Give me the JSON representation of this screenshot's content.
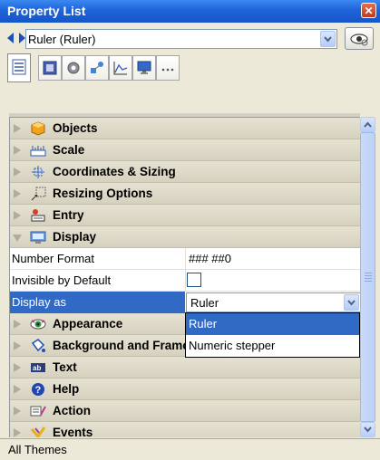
{
  "window": {
    "title": "Property List",
    "close_glyph": "✕"
  },
  "object_selector": {
    "value": "Ruler (Ruler)"
  },
  "tabs": [
    {
      "name": "properties",
      "icon": "list-icon",
      "active": true
    },
    {
      "name": "object",
      "icon": "object-icon",
      "active": false
    },
    {
      "name": "settings",
      "icon": "gear-icon",
      "active": false
    },
    {
      "name": "shapes",
      "icon": "shapes-icon",
      "active": false
    },
    {
      "name": "chart",
      "icon": "chart-icon",
      "active": false
    },
    {
      "name": "screen",
      "icon": "monitor-icon",
      "active": false
    },
    {
      "name": "more",
      "icon": "more-icon",
      "active": false
    }
  ],
  "categories": {
    "objects": "Objects",
    "scale": "Scale",
    "coordinates": "Coordinates & Sizing",
    "resizing": "Resizing Options",
    "entry": "Entry",
    "display": "Display",
    "appearance": "Appearance",
    "background": "Background and Frame",
    "text": "Text",
    "help": "Help",
    "action": "Action",
    "events": "Events"
  },
  "display_props": {
    "number_format": {
      "label": "Number Format",
      "value": "### ##0"
    },
    "invisible_default": {
      "label": "Invisible by Default",
      "checked": false
    },
    "display_as": {
      "label": "Display as",
      "value": "Ruler"
    }
  },
  "dropdown": {
    "options": [
      "Ruler",
      "Numeric stepper"
    ],
    "selected": "Ruler"
  },
  "status": {
    "text": "All Themes"
  },
  "colors": {
    "title_bar": "#1F63D9",
    "selection": "#316AC5",
    "category_bg": "#DEDAC8"
  }
}
